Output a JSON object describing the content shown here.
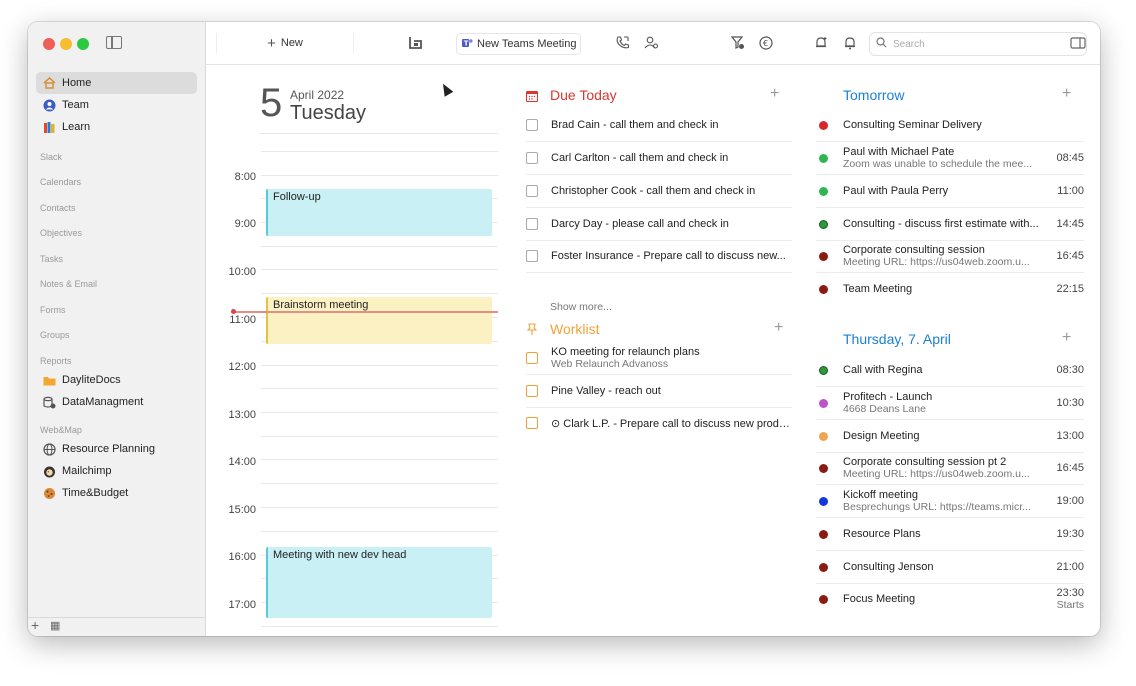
{
  "sidebar": {
    "items": [
      {
        "label": "Home",
        "icon": "house-icon"
      },
      {
        "label": "Team",
        "icon": "team-icon"
      },
      {
        "label": "Learn",
        "icon": "books-icon"
      }
    ],
    "sections": {
      "slack": "Slack",
      "calendars": "Calendars",
      "contacts": "Contacts",
      "objectives": "Objectives",
      "tasks": "Tasks",
      "notes_email": "Notes & Email",
      "forms": "Forms",
      "groups": "Groups",
      "reports": "Reports",
      "webmap": "Web&Map"
    },
    "reports": [
      {
        "label": "DayliteDocs",
        "icon": "folder-icon"
      },
      {
        "label": "DataManagment",
        "icon": "database-icon"
      }
    ],
    "webmap": [
      {
        "label": "Resource Planning",
        "icon": "globe-icon"
      },
      {
        "label": "Mailchimp",
        "icon": "mailchimp-icon"
      },
      {
        "label": "Time&Budget",
        "icon": "cookie-icon"
      }
    ],
    "bottom": {
      "add": "+",
      "calendar_icon": "▦"
    }
  },
  "toolbar": {
    "new_label": "New",
    "teams_label": "New Teams Meeting",
    "search_placeholder": "Search"
  },
  "calendar": {
    "day_number": "5",
    "month_year": "April 2022",
    "weekday": "Tuesday",
    "hours": [
      "8:00",
      "9:00",
      "10:00",
      "11:00",
      "12:00",
      "13:00",
      "14:00",
      "15:00",
      "16:00",
      "17:00"
    ],
    "events": [
      {
        "title": "Follow-up",
        "color": "#c9f0f4",
        "bar": "#5ec8d8"
      },
      {
        "title": "Brainstorm meeting",
        "color": "#fbf1c3",
        "bar": "#e2c440"
      },
      {
        "title": "Meeting with new dev head",
        "color": "#c9f0f4",
        "bar": "#5ec8d8"
      }
    ]
  },
  "due_today": {
    "title": "Due Today",
    "color": "#d8382f",
    "items": [
      "Brad Cain - call them and check in",
      "Carl Carlton - call them and check in",
      "Christopher Cook - call them and check in",
      "Darcy Day - please call and check in",
      "Foster Insurance - Prepare call to discuss new..."
    ],
    "show_more": "Show more..."
  },
  "worklist": {
    "title": "Worklist",
    "color": "#f0a23a",
    "items": [
      {
        "title": "KO meeting for relaunch plans",
        "sub": "Web Relaunch Advanoss"
      },
      {
        "title": "Pine Valley - reach out",
        "sub": ""
      },
      {
        "title": "⊙ Clark L.P. - Prepare call to discuss new produ...",
        "sub": ""
      }
    ]
  },
  "tomorrow": {
    "title": "Tomorrow",
    "color": "#1a7fd6",
    "items": [
      {
        "title": "Consulting Seminar Delivery",
        "sub": "",
        "time": "",
        "dot": "#d8262e"
      },
      {
        "title": "Paul with Michael Pate",
        "sub": "Zoom was unable to schedule the mee...",
        "time": "08:45",
        "dot": "#2fb650"
      },
      {
        "title": "Paul with Paula Perry",
        "sub": "",
        "time": "11:00",
        "dot": "#2fb650"
      },
      {
        "title": "Consulting - discuss first estimate with...",
        "sub": "",
        "time": "14:45",
        "dot": "#2a9a3a"
      },
      {
        "title": "Corporate consulting session",
        "sub": "Meeting URL: https://us04web.zoom.u...",
        "time": "16:45",
        "dot": "#8b1b10"
      },
      {
        "title": "Team Meeting",
        "sub": "",
        "time": "22:15",
        "dot": "#8b1b10"
      }
    ]
  },
  "thursday": {
    "title": "Thursday, 7. April",
    "color": "#1a7fd6",
    "items": [
      {
        "title": "Call with Regina",
        "sub": "",
        "time": "08:30",
        "dot": "#2a9a3a"
      },
      {
        "title": "Profitech - Launch",
        "sub": "4668 Deans Lane",
        "time": "10:30",
        "dot": "#c052c8"
      },
      {
        "title": "Design Meeting",
        "sub": "",
        "time": "13:00",
        "dot": "#f0a550"
      },
      {
        "title": "Corporate consulting session pt 2",
        "sub": "Meeting URL: https://us04web.zoom.u...",
        "time": "16:45",
        "dot": "#8b1b10"
      },
      {
        "title": "Kickoff meeting",
        "sub": "Besprechungs URL: https://teams.micr...",
        "time": "19:00",
        "dot": "#1638d8"
      },
      {
        "title": "Resource Plans",
        "sub": "",
        "time": "19:30",
        "dot": "#8b1b10"
      },
      {
        "title": "Consulting Jenson",
        "sub": "",
        "time": "21:00",
        "dot": "#8b1b10"
      },
      {
        "title": "Focus Meeting",
        "sub": "",
        "time": "23:30",
        "time2": "Starts",
        "dot": "#8b1b10"
      }
    ]
  }
}
